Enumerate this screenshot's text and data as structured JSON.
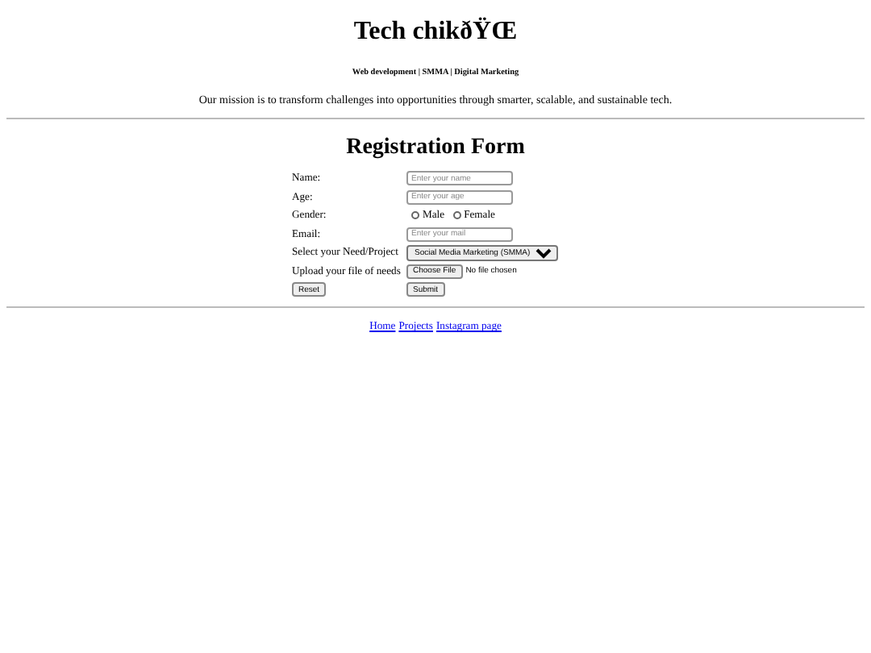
{
  "header": {
    "title": "Tech chikðŸŒ",
    "tagline": "Web development | SMMA | Digital Marketing",
    "mission": "Our mission is to transform challenges into opportunities through smarter, scalable, and sustainable tech."
  },
  "form": {
    "heading": "Registration Form",
    "fields": [
      {
        "kind": "text",
        "label": "Name:",
        "placeholder": "Enter your name"
      },
      {
        "kind": "text",
        "label": "Age:",
        "placeholder": "Enter your age"
      },
      {
        "kind": "radio",
        "label": "Gender:",
        "options": [
          {
            "label": "Male",
            "selected": false
          },
          {
            "label": "Female",
            "selected": false
          }
        ]
      },
      {
        "kind": "text",
        "label": "Email:",
        "placeholder": "Enter your mail"
      },
      {
        "kind": "select",
        "label": "Select your Need/Project",
        "value": "Social Media Marketing (SMMA)"
      },
      {
        "kind": "file",
        "label": "Upload your file of needs",
        "button": "Choose File",
        "status": "No file chosen"
      }
    ],
    "buttons": [
      "Reset",
      "Submit"
    ]
  },
  "nav": {
    "links": [
      "Home",
      "Projects",
      "Instagram page"
    ]
  }
}
